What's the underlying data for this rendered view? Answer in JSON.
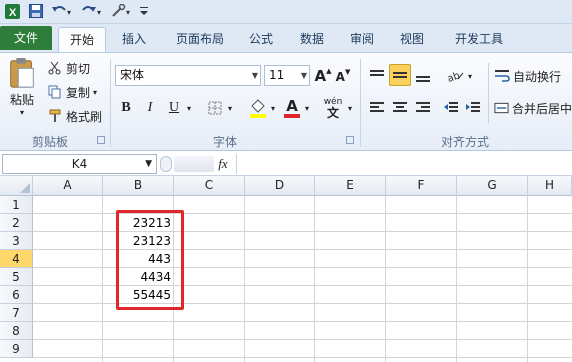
{
  "tabs": [
    "文件",
    "开始",
    "插入",
    "页面布局",
    "公式",
    "数据",
    "审阅",
    "视图",
    "开发工具"
  ],
  "ribbon": {
    "clipboard": {
      "paste": "粘贴",
      "cut": "剪切",
      "copy": "复制",
      "format_painter": "格式刷",
      "group": "剪贴板"
    },
    "font": {
      "name": "宋体",
      "size": "11",
      "bold": "B",
      "italic": "I",
      "underline": "U",
      "grow": "A",
      "shrink": "A",
      "phonetic": "wén",
      "group": "字体"
    },
    "alignment": {
      "wrap": "自动换行",
      "merge": "合并后居中",
      "group": "对齐方式"
    }
  },
  "formula_bar": {
    "namebox": "K4",
    "fx": "fx",
    "value": ""
  },
  "columns": [
    "A",
    "B",
    "C",
    "D",
    "E",
    "F",
    "G",
    "H"
  ],
  "rows": [
    "1",
    "2",
    "3",
    "4",
    "5",
    "6",
    "7",
    "8",
    "9"
  ],
  "selected_row": "4",
  "cells": {
    "B2": "23213",
    "B3": "23123",
    "B4": "443",
    "B5": "4434",
    "B6": "55445"
  },
  "colors": {
    "file_tab": "#2f7d3b",
    "highlight": "#e0262d",
    "selected_header": "#ffd86b"
  }
}
